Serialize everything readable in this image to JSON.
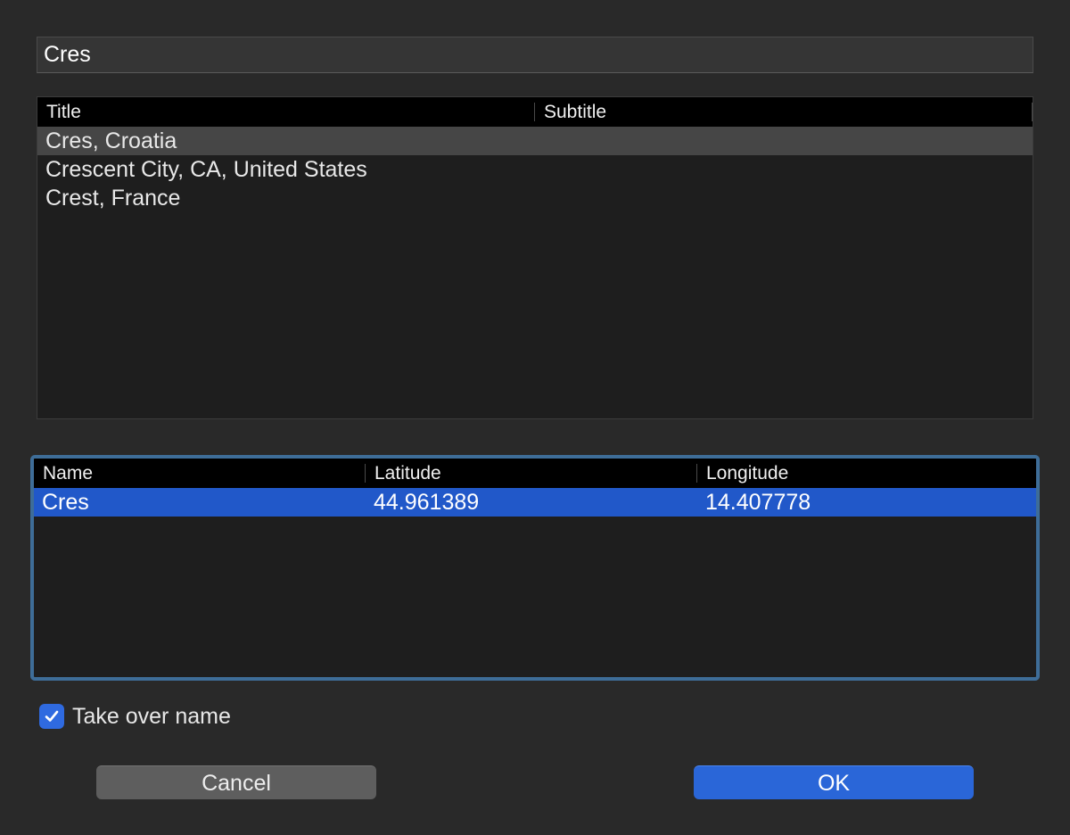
{
  "search": {
    "value": "Cres"
  },
  "results_table": {
    "columns": [
      "Title",
      "Subtitle"
    ],
    "rows": [
      {
        "title": "Cres, Croatia",
        "subtitle": ""
      },
      {
        "title": "Crescent City, CA, United States",
        "subtitle": ""
      },
      {
        "title": "Crest, France",
        "subtitle": ""
      }
    ]
  },
  "coords_table": {
    "columns": [
      "Name",
      "Latitude",
      "Longitude"
    ],
    "rows": [
      {
        "name": "Cres",
        "latitude": "44.961389",
        "longitude": "14.407778"
      }
    ]
  },
  "take_over_name": {
    "label": "Take over name",
    "checked": true
  },
  "buttons": {
    "cancel": "Cancel",
    "ok": "OK"
  },
  "colors": {
    "accent": "#2a66d8",
    "selection_blue": "#2158c9",
    "focus_ring": "#3e6d98",
    "background": "#292929"
  },
  "icons": {
    "checkbox": "checkmark-icon"
  }
}
